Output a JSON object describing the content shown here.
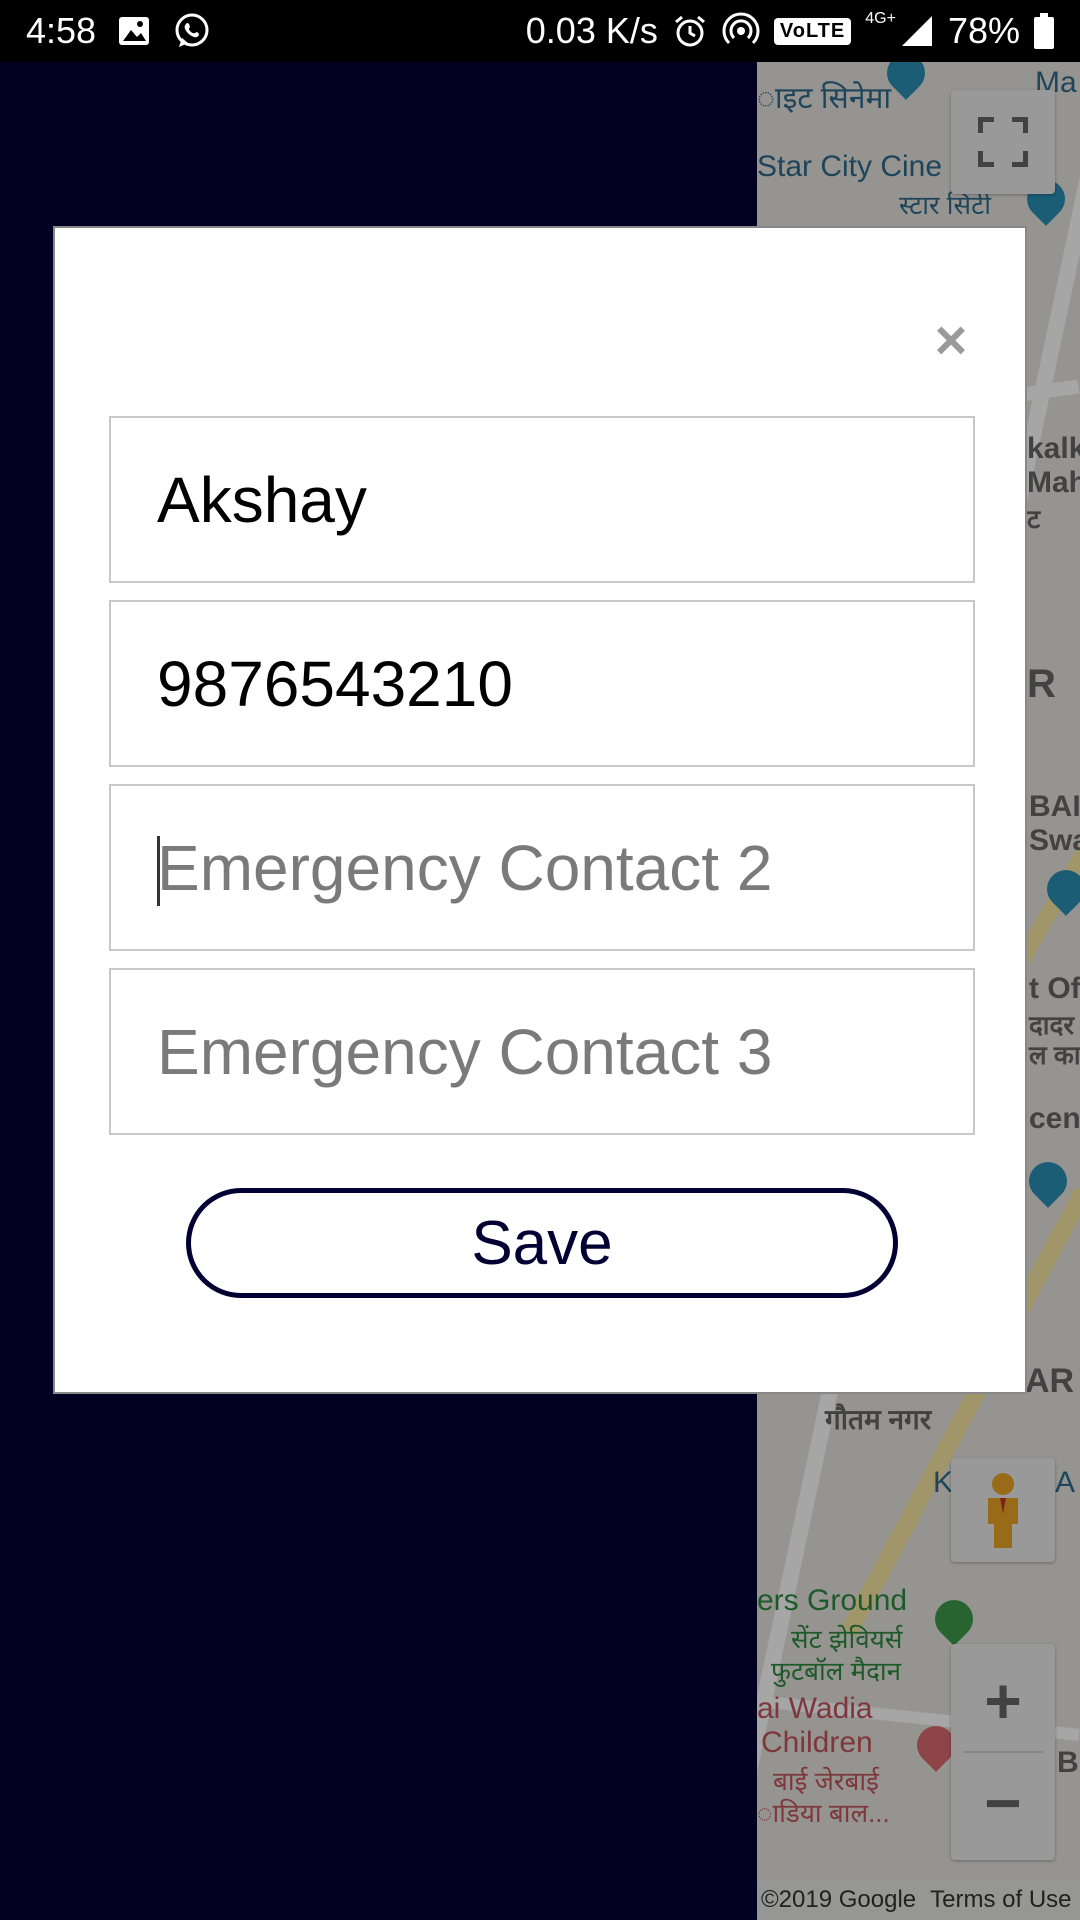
{
  "status_bar": {
    "time": "4:58",
    "network_speed": "0.03 K/s",
    "volte": "VoLTE",
    "network_type": "4G+",
    "battery": "78%",
    "icons": [
      "image-icon",
      "whatsapp-icon",
      "alarm-icon",
      "hotspot-icon",
      "signal-icon",
      "battery-icon"
    ]
  },
  "map": {
    "labels": {
      "cinema_hi": "ाइट सिनेमा",
      "star_city": "Star City Cine",
      "star_city_hi": "स्टार सिटी",
      "kalk": "kalk",
      "mah": "Mah",
      "t": "ट",
      "r1": "R",
      "bai": "BAI",
      "swa": "Swa",
      "t_of": "t Of",
      "dadar": "दादर",
      "la_ka": "ल का",
      "cent": "cent",
      "gautam": "गौतम नगर",
      "ar": "AR",
      "ka": "K",
      "a": "A",
      "grounds": "ers Ground",
      "grounds_hi1": "सेंट झेवियर्स",
      "grounds_hi2": "फुटबॉल मैदान",
      "wadia1": "ai Wadia",
      "wadia2": "Children",
      "wadia_hi1": "बाई जेरबाई",
      "wadia_hi2": "ाडिया बाल...",
      "ma": "Ma",
      "b": "B"
    },
    "controls": {
      "zoom_in": "+",
      "zoom_out": "−"
    },
    "attribution": {
      "copyright": "©2019 Google",
      "terms": "Terms of Use"
    }
  },
  "modal": {
    "close": "×",
    "fields": {
      "name_value": "Akshay",
      "contact1_value": "9876543210",
      "contact2_placeholder": "Emergency Contact 2",
      "contact3_placeholder": "Emergency Contact 3"
    },
    "save_label": "Save"
  },
  "colors": {
    "navy": "#020033",
    "map_bg": "#e6e4df"
  }
}
